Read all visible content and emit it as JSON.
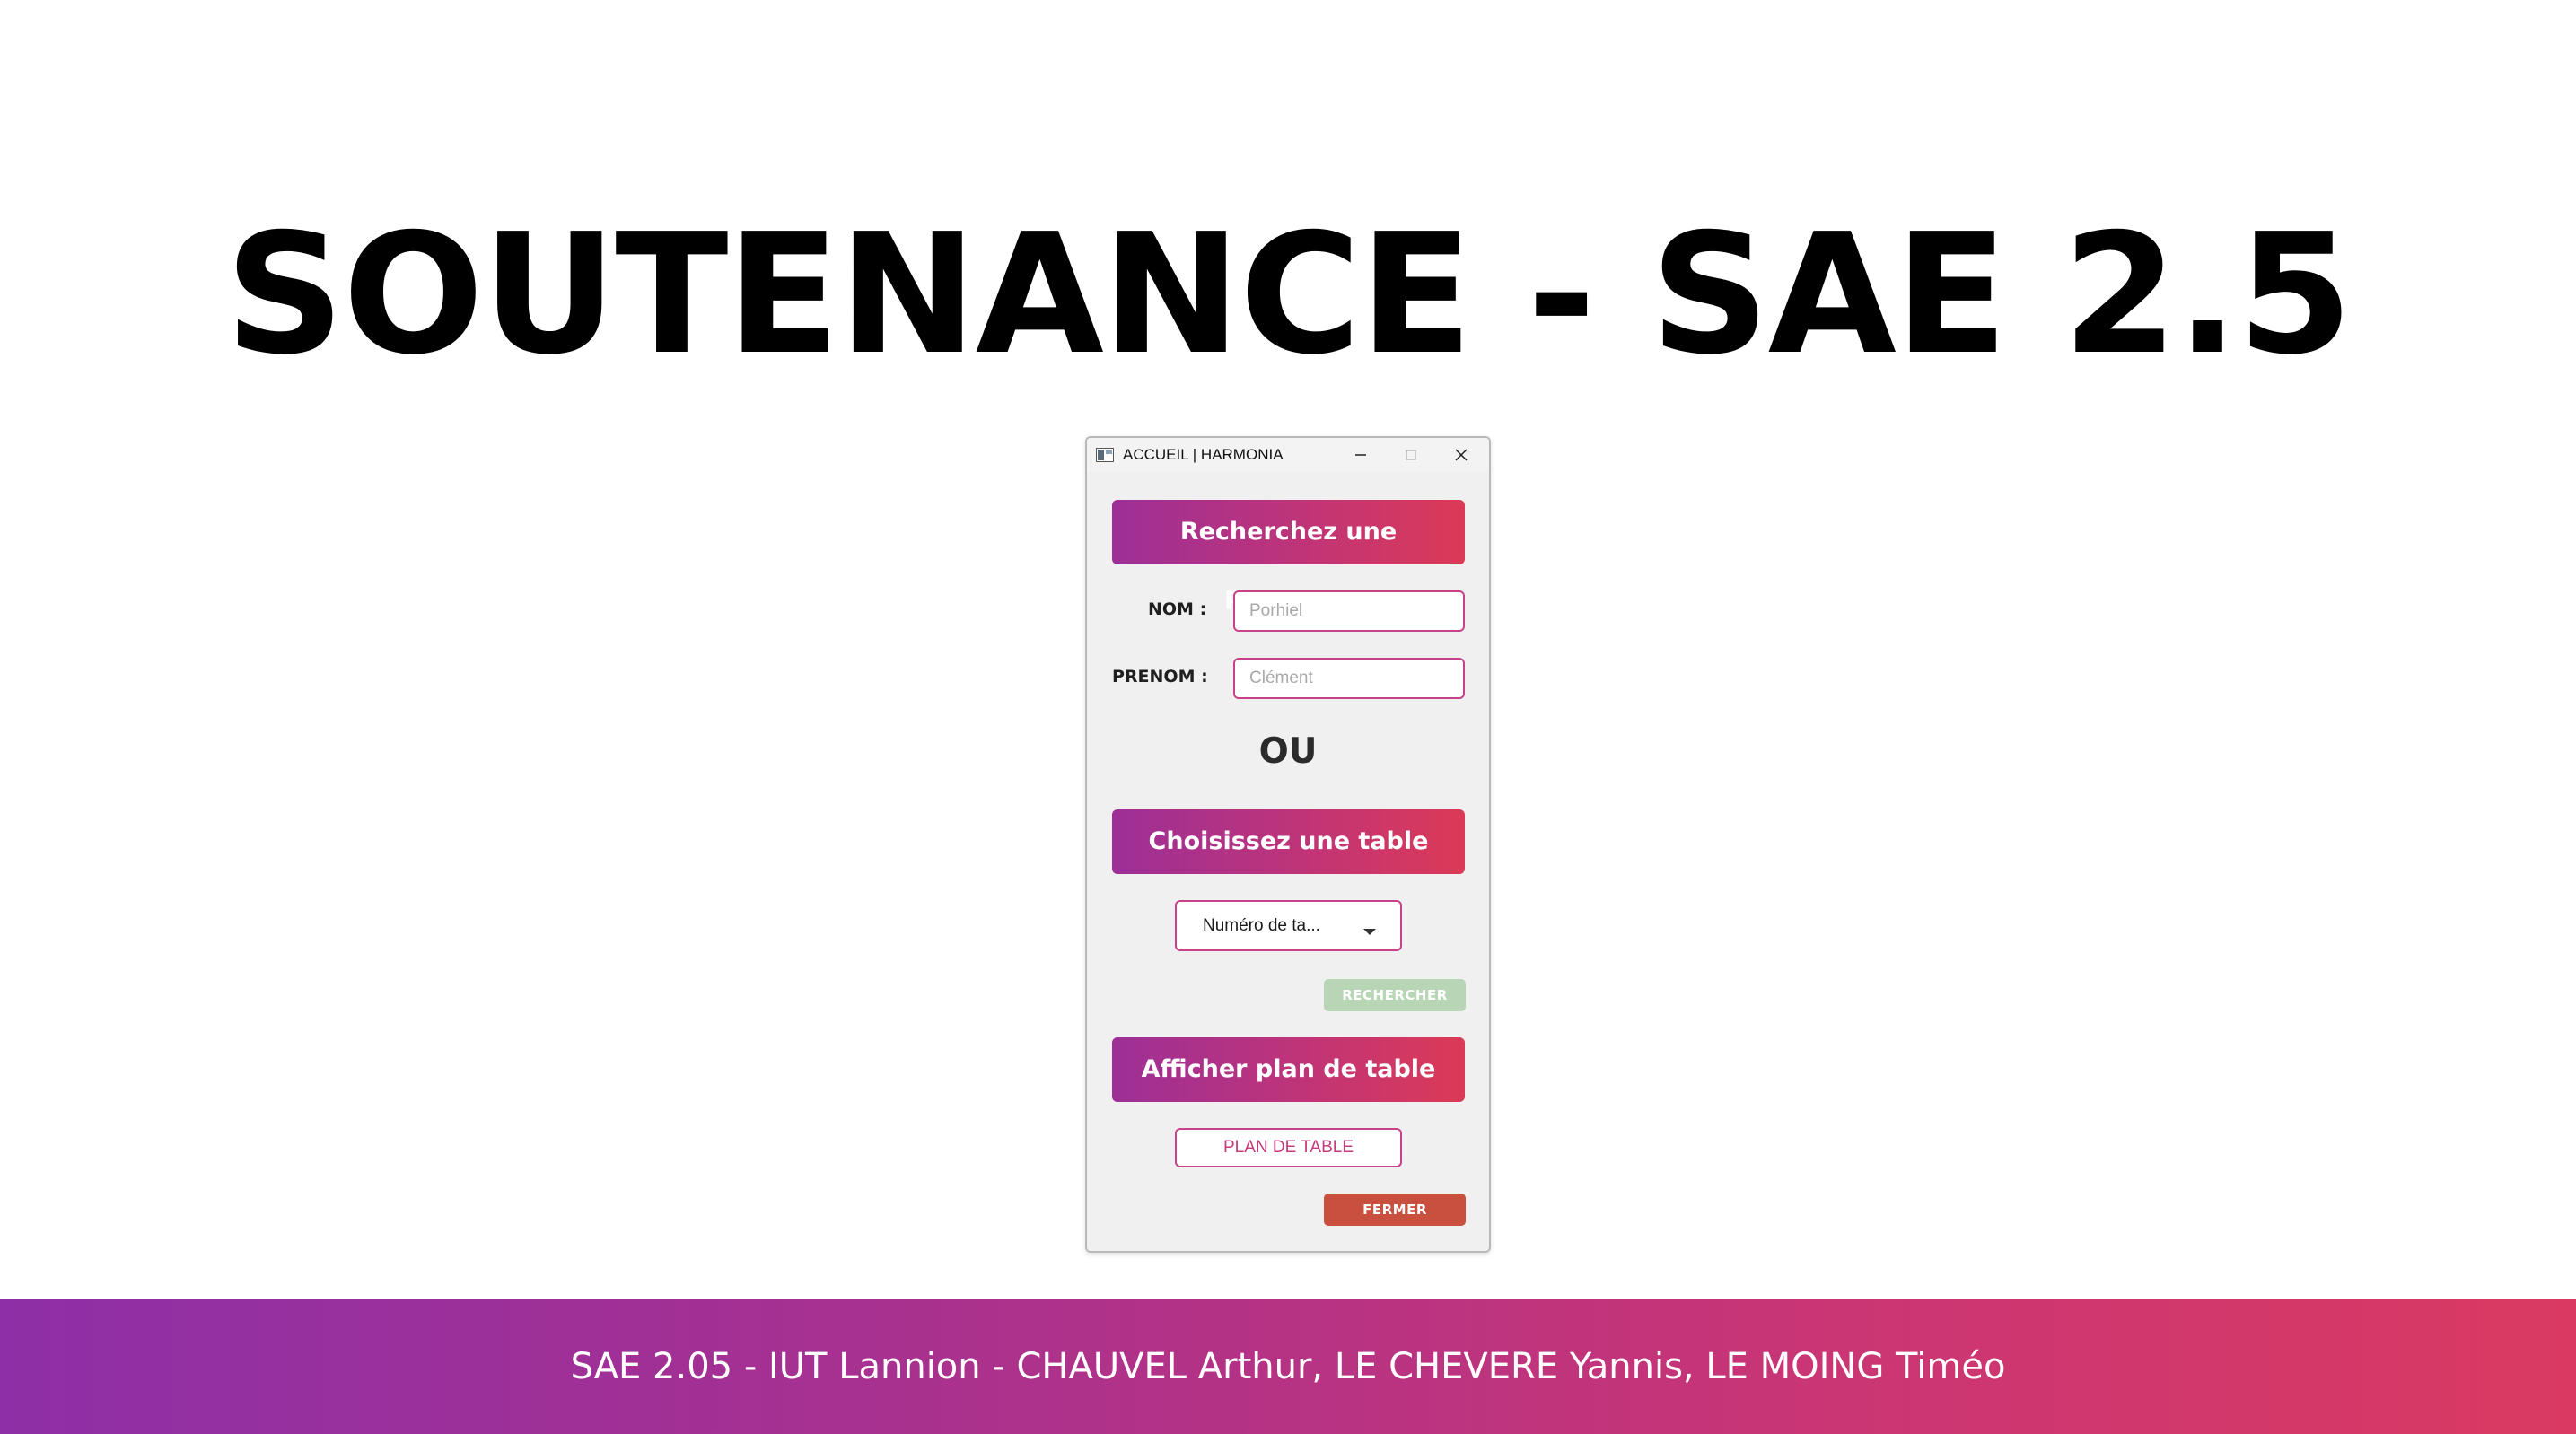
{
  "slide": {
    "title": "SOUTENANCE - SAE 2.5"
  },
  "window": {
    "title": "ACCUEIL | HARMONIA",
    "icon": "app-window-icon",
    "controls": [
      "minimize-icon",
      "maximize-icon",
      "close-icon"
    ]
  },
  "app": {
    "search_person_banner": "Recherchez une personne",
    "nom_label": "NOM :",
    "nom_placeholder": "Porhiel",
    "prenom_label": "PRENOM :",
    "prenom_placeholder": "Clément",
    "or_label": "OU",
    "choose_table_banner": "Choisissez une table",
    "table_select_value": "Numéro de ta...",
    "search_button": "RECHERCHER",
    "show_plan_banner": "Afficher plan de table",
    "plan_button": "PLAN DE TABLE",
    "close_button": "FERMER"
  },
  "footer": {
    "text": "SAE 2.05 - IUT Lannion - CHAUVEL Arthur, LE CHEVERE Yannis, LE MOING Timéo"
  },
  "colors": {
    "banner_gradient_start": "#9d2f97",
    "banner_gradient_end": "#dc3a56",
    "input_border": "#c8428a",
    "search_button_bg": "#b8d6b6",
    "close_button_bg": "#c9503f",
    "footer_gradient_start": "#8e2fa7",
    "footer_gradient_end": "#da3a62"
  }
}
